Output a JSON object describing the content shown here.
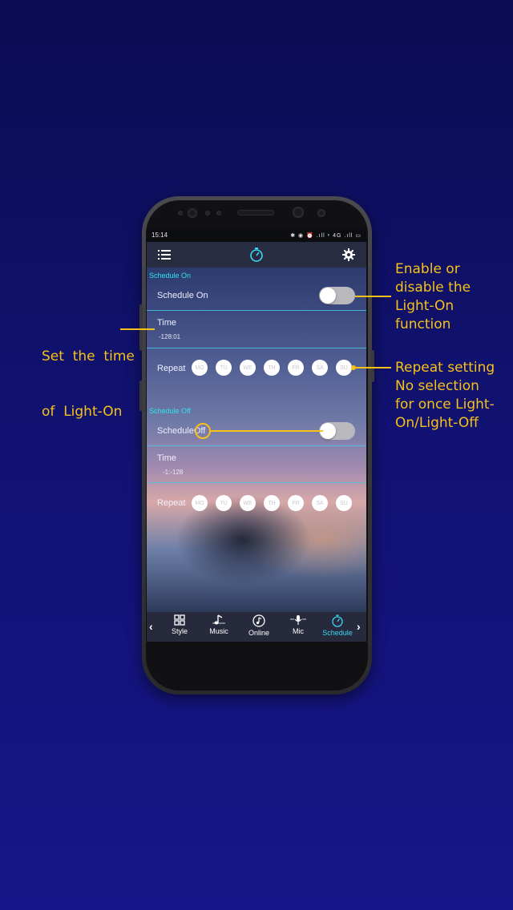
{
  "annotations": {
    "enable": [
      "Enable or",
      "disable the",
      "Light-On",
      "function"
    ],
    "set_time": [
      "Set  the  time",
      "of  Light-On"
    ],
    "repeat": [
      "Repeat setting",
      "No selection",
      "for once Light-",
      "On/Light-Off"
    ]
  },
  "colors": {
    "annotation": "#f6c21a",
    "accent": "#2fe3ee",
    "background_top": "#0b0c52",
    "background_bottom": "#16168a"
  },
  "status_bar": {
    "time": "15:14",
    "icons_text": "✱ ◉ ⏰ .ıll ⁿ 4G .ıll ▭"
  },
  "app_bar": {
    "menu_icon": "menu-icon",
    "center_icon": "timer-icon",
    "settings_icon": "gear-icon"
  },
  "schedule_on": {
    "section_title": "Schedule On",
    "toggle_label": "Schedule On",
    "toggle_state": "off",
    "time_label": "Time",
    "time_value": "-128:01",
    "repeat_label": "Repeat",
    "days": [
      "MO",
      "TU",
      "WE",
      "TH",
      "FR",
      "SA",
      "SU"
    ]
  },
  "schedule_off": {
    "section_title": "Schedule Off",
    "toggle_label_prefix": "Schedule",
    "toggle_label_suffix": "Off",
    "toggle_state": "off",
    "time_label": "Time",
    "time_value": "-1:-128",
    "repeat_label": "Repeat",
    "days": [
      "MO",
      "TU",
      "WE",
      "TH",
      "FR",
      "SA",
      "SU"
    ]
  },
  "bottom_nav": {
    "left_arrow": "‹",
    "right_arrow": "›",
    "items": [
      {
        "label": "Style",
        "icon": "grid-icon"
      },
      {
        "label": "Music",
        "icon": "music-note-icon"
      },
      {
        "label": "Online",
        "icon": "online-music-icon"
      },
      {
        "label": "Mic",
        "icon": "microphone-icon"
      },
      {
        "label": "Schedule",
        "icon": "timer-icon",
        "active": true
      }
    ]
  }
}
